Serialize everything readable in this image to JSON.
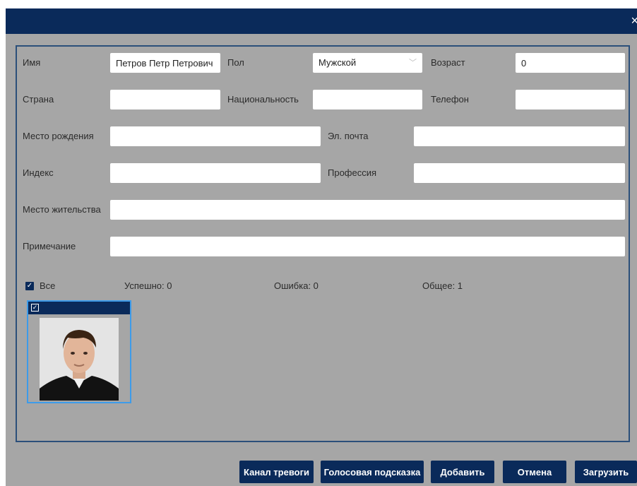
{
  "dialog": {
    "close_glyph": "×"
  },
  "form": {
    "name": {
      "label": "Имя",
      "value": "Петров Петр Петрович"
    },
    "gender": {
      "label": "Пол",
      "value": "Мужской"
    },
    "age": {
      "label": "Возраст",
      "value": "0"
    },
    "country": {
      "label": "Страна",
      "value": ""
    },
    "nationality": {
      "label": "Национальность",
      "value": ""
    },
    "phone": {
      "label": "Телефон",
      "value": ""
    },
    "birthplace": {
      "label": "Место рождения",
      "value": ""
    },
    "email": {
      "label": "Эл. почта",
      "value": ""
    },
    "zip": {
      "label": "Индекс",
      "value": ""
    },
    "profession": {
      "label": "Профессия",
      "value": ""
    },
    "residence": {
      "label": "Место жительства",
      "value": ""
    },
    "note": {
      "label": "Примечание",
      "value": ""
    }
  },
  "stats": {
    "all_label": "Все",
    "success": "Успешно: 0",
    "error": "Ошибка: 0",
    "total": "Общее: 1"
  },
  "buttons": {
    "alarm_channel": "Канал тревоги",
    "voice_prompt": "Голосовая подсказка",
    "add": "Добавить",
    "cancel": "Отмена",
    "upload": "Загрузить"
  },
  "colors": {
    "accent": "#0a2a5a",
    "panel_bg": "#a6a6a6",
    "selection": "#3d9be9"
  }
}
